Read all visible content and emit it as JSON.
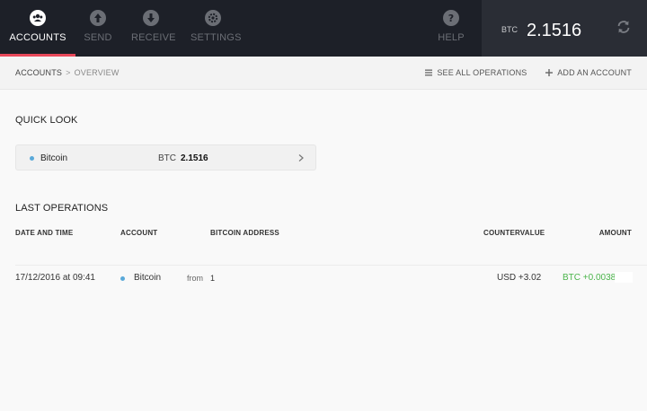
{
  "nav": {
    "items": [
      {
        "label": "ACCOUNTS",
        "icon": "accounts-icon",
        "active": true
      },
      {
        "label": "SEND",
        "icon": "send-icon"
      },
      {
        "label": "RECEIVE",
        "icon": "receive-icon"
      },
      {
        "label": "SETTINGS",
        "icon": "settings-icon"
      }
    ],
    "help": {
      "label": "HELP",
      "icon": "help-icon"
    }
  },
  "balance": {
    "currency": "BTC",
    "value": "2.1516",
    "icon": "sync-icon"
  },
  "breadcrumb": {
    "root": "ACCOUNTS",
    "separator": ">",
    "current": "OVERVIEW"
  },
  "actions": {
    "see_all": "SEE ALL OPERATIONS",
    "add_account": "ADD AN ACCOUNT"
  },
  "quick_look": {
    "title": "QUICK LOOK",
    "accounts": [
      {
        "name": "Bitcoin",
        "currency": "BTC",
        "balance": "2.1516"
      }
    ]
  },
  "last_operations": {
    "title": "LAST OPERATIONS",
    "columns": [
      "DATE AND TIME",
      "ACCOUNT",
      "BITCOIN ADDRESS",
      "COUNTERVALUE",
      "AMOUNT"
    ],
    "rows": [
      {
        "datetime": "17/12/2016 at 09:41",
        "account": "Bitcoin",
        "direction": "from",
        "address": "1",
        "countervalue": "USD +3.02",
        "amount": "BTC +0.0038"
      }
    ]
  },
  "colors": {
    "accent": "#e8485a",
    "topbar": "#1d2028",
    "positive": "#4cb54c",
    "account_dot": "#5aa9d9"
  }
}
